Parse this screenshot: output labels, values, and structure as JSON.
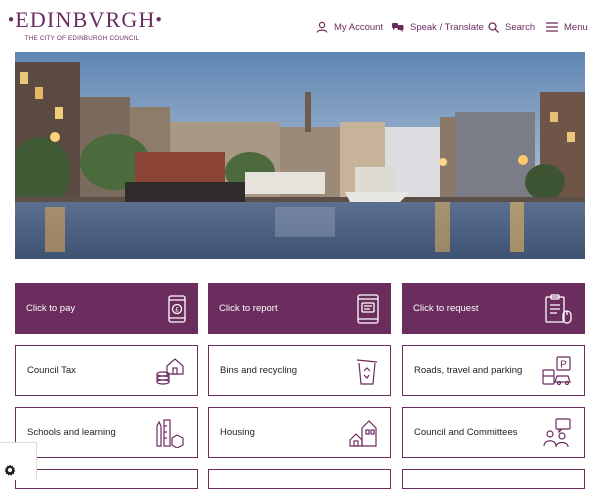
{
  "brand": {
    "name": "EDINBVRGH",
    "tagline": "THE CITY OF EDINBURGH COUNCIL",
    "color": "#6b2c5e"
  },
  "nav": {
    "account": "My Account",
    "speak": "Speak / Translate",
    "search": "Search",
    "menu": "Menu"
  },
  "tiles": {
    "pay": "Click to pay",
    "report": "Click to report",
    "request": "Click to request",
    "council_tax": "Council Tax",
    "bins": "Bins and recycling",
    "roads": "Roads, travel and parking",
    "schools": "Schools and learning",
    "housing": "Housing",
    "committees": "Council and Committees"
  },
  "icons": {
    "account": "person-icon",
    "speak": "speech-translate-icon",
    "search": "search-icon",
    "menu": "hamburger-menu-icon",
    "pay": "phone-pound-icon",
    "report": "phone-report-icon",
    "request": "clipboard-mouse-icon",
    "council_tax": "house-coins-icon",
    "bins": "recycling-bin-icon",
    "roads": "parking-bus-car-icon",
    "schools": "pencil-ruler-books-icon",
    "housing": "houses-icon",
    "committees": "people-speech-icon",
    "cookie": "gear-icon"
  }
}
